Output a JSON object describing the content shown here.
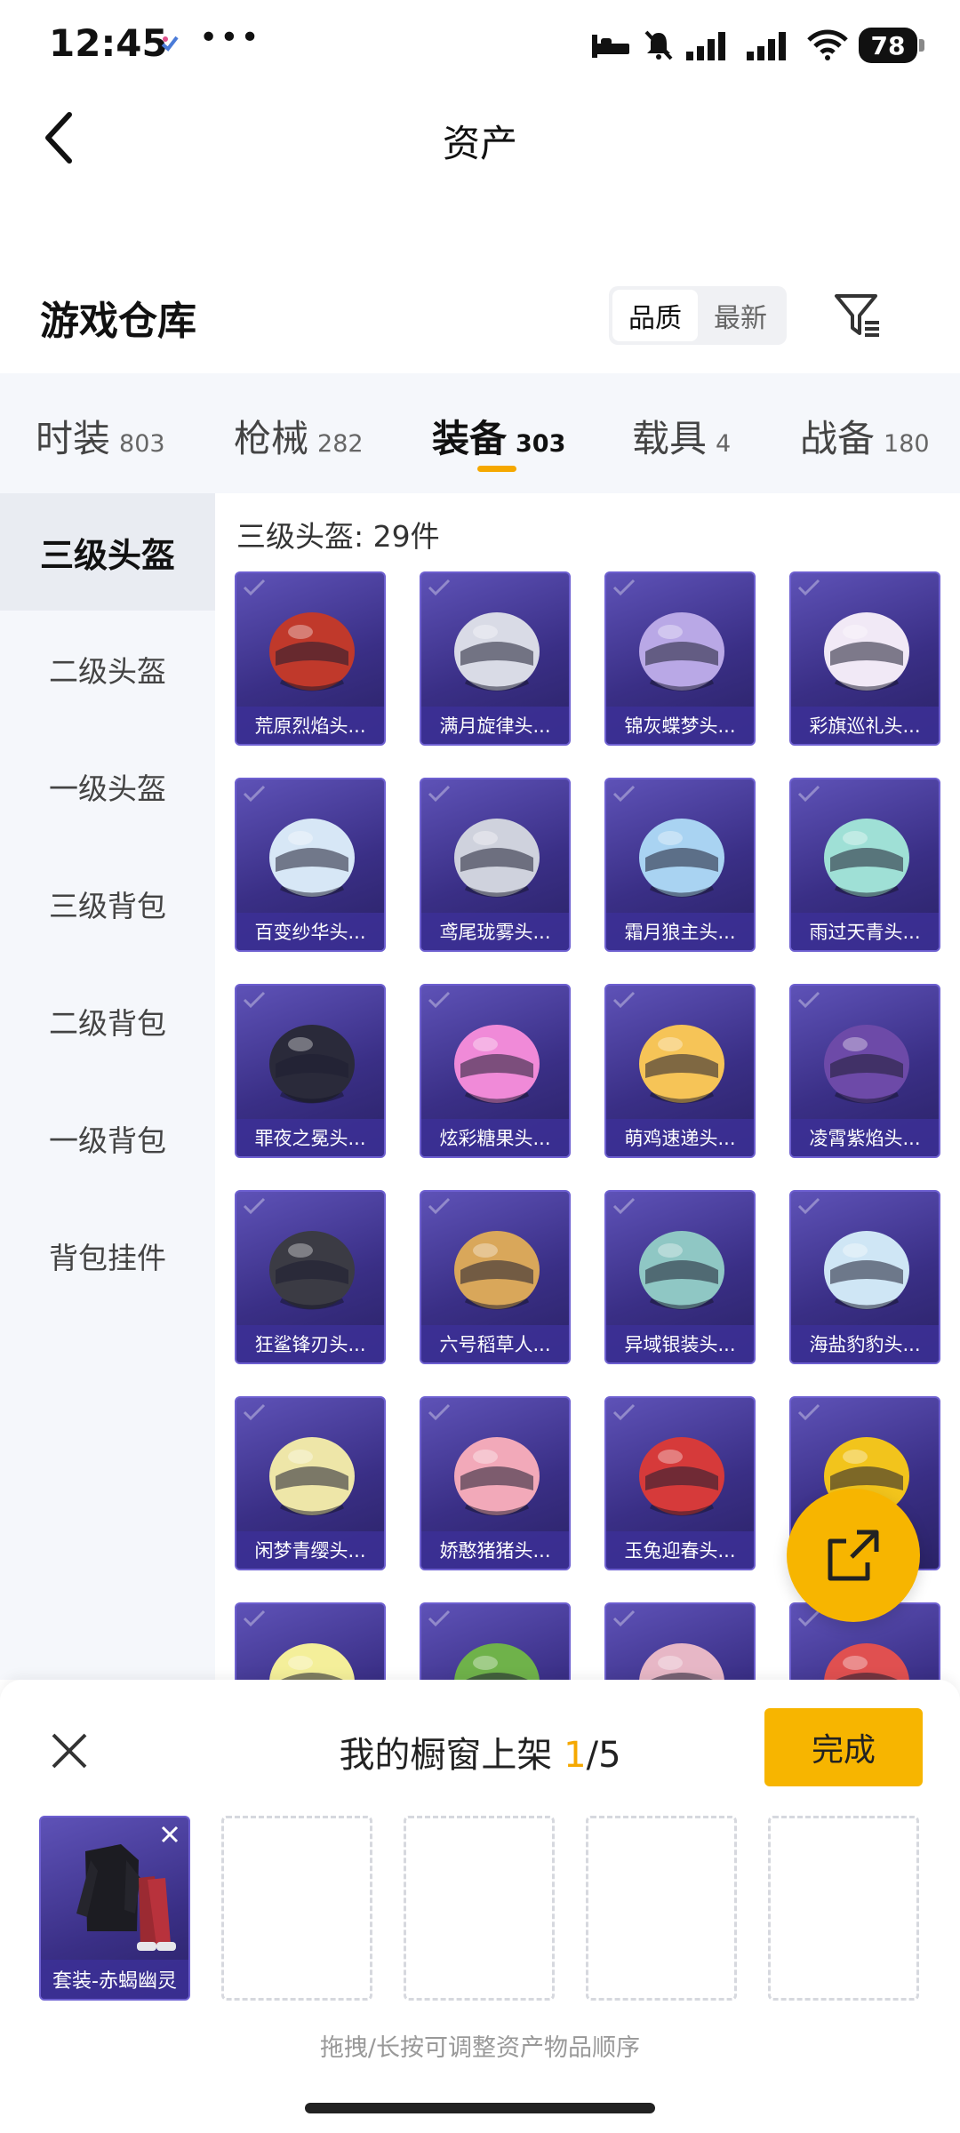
{
  "status_bar": {
    "time": "12:45",
    "more_dots": "•••",
    "battery": "78"
  },
  "nav": {
    "title": "资产"
  },
  "warehouse": {
    "title": "游戏仓库",
    "sort_options": [
      "品质",
      "最新"
    ],
    "sort_active_index": 0
  },
  "categories": [
    {
      "label": "时装",
      "count": "803"
    },
    {
      "label": "枪械",
      "count": "282"
    },
    {
      "label": "装备",
      "count": "303"
    },
    {
      "label": "载具",
      "count": "4"
    },
    {
      "label": "战备",
      "count": "180"
    }
  ],
  "category_active_index": 2,
  "sidebar": {
    "items": [
      "三级头盔",
      "二级头盔",
      "一级头盔",
      "三级背包",
      "二级背包",
      "一级背包",
      "背包挂件"
    ],
    "active_index": 0
  },
  "main": {
    "subcat_title": "三级头盔: 29件",
    "items": [
      {
        "name": "荒原烈焰头...",
        "color": "#c0392b"
      },
      {
        "name": "满月旋律头...",
        "color": "#d9dbe6"
      },
      {
        "name": "锦灰蝶梦头...",
        "color": "#b9a8e6"
      },
      {
        "name": "彩旗巡礼头...",
        "color": "#f1e9f6"
      },
      {
        "name": "百变纱华头...",
        "color": "#d7e7f6"
      },
      {
        "name": "鸢尾珑雾头...",
        "color": "#cfd2dd"
      },
      {
        "name": "霜月狼主头...",
        "color": "#a9d3f2"
      },
      {
        "name": "雨过天青头...",
        "color": "#9fe0d6"
      },
      {
        "name": "罪夜之冕头...",
        "color": "#2a2a3a"
      },
      {
        "name": "炫彩糖果头...",
        "color": "#f08ad8"
      },
      {
        "name": "萌鸡速递头...",
        "color": "#f6c457"
      },
      {
        "name": "凌霄紫焰头...",
        "color": "#6d4aa8"
      },
      {
        "name": "狂鲨锋刃头...",
        "color": "#3b3b44"
      },
      {
        "name": "六号稻草人...",
        "color": "#d9a75a"
      },
      {
        "name": "异域银装头...",
        "color": "#8fc7c4"
      },
      {
        "name": "海盐豹豹头...",
        "color": "#cfe6f5"
      },
      {
        "name": "闲梦青缨头...",
        "color": "#eee6a8"
      },
      {
        "name": "娇憨猪猪头...",
        "color": "#f2a9b9"
      },
      {
        "name": "玉兔迎春头...",
        "color": "#d63a3a"
      },
      {
        "name": "",
        "color": "#f2c41c"
      },
      {
        "name": "",
        "color": "#f4ef9a"
      },
      {
        "name": "",
        "color": "#6fb24a"
      },
      {
        "name": "",
        "color": "#e7b7c6"
      },
      {
        "name": "",
        "color": "#e05050"
      }
    ]
  },
  "panel": {
    "title_prefix": "我的橱窗上架 ",
    "current": "1",
    "total": "/5",
    "done_label": "完成",
    "slot_item_name": "套装-赤蝎幽灵",
    "hint": "拖拽/长按可调整资产物品顺序"
  },
  "colors": {
    "accent": "#f7b500",
    "card_purple": "#3a2f86"
  }
}
